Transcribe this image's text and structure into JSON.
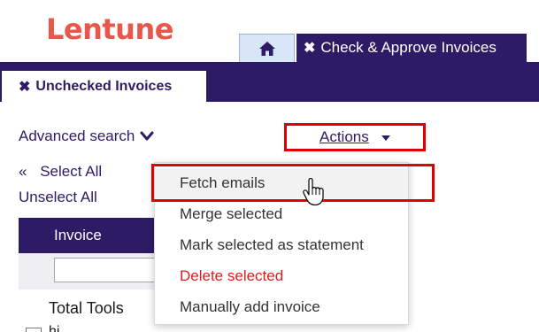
{
  "brand": {
    "logo_text": "Lentune",
    "logo_color": "#e8584a"
  },
  "tabs": {
    "home_icon": "home-icon",
    "main_tab_close": "✖",
    "main_tab_label": "Check & Approve Invoices"
  },
  "subtab": {
    "close": "✖",
    "label": "Unchecked Invoices"
  },
  "toolbar": {
    "advanced_search": "Advanced search",
    "advanced_search_icon": "chevron-down-icon",
    "actions_label": "Actions",
    "actions_icon": "caret-down-icon"
  },
  "selection": {
    "select_all_icon": "«",
    "select_all": "Select All",
    "unselect_all": "Unselect All"
  },
  "table": {
    "column_invoice": "Invoice",
    "filter_placeholder": "",
    "row_name": "Total Tools",
    "row_sub": "hi"
  },
  "actions_menu": {
    "items": [
      {
        "label": "Fetch emails",
        "state": "hover"
      },
      {
        "label": "Merge selected",
        "state": "normal"
      },
      {
        "label": "Mark selected as statement",
        "state": "normal"
      },
      {
        "label": "Delete selected",
        "state": "danger"
      },
      {
        "label": "Manually add invoice",
        "state": "normal"
      }
    ]
  },
  "colors": {
    "primary": "#2d1b66",
    "danger": "#e01b1b",
    "highlight": "#e00000",
    "home_tab_bg": "#d9e6f7"
  }
}
